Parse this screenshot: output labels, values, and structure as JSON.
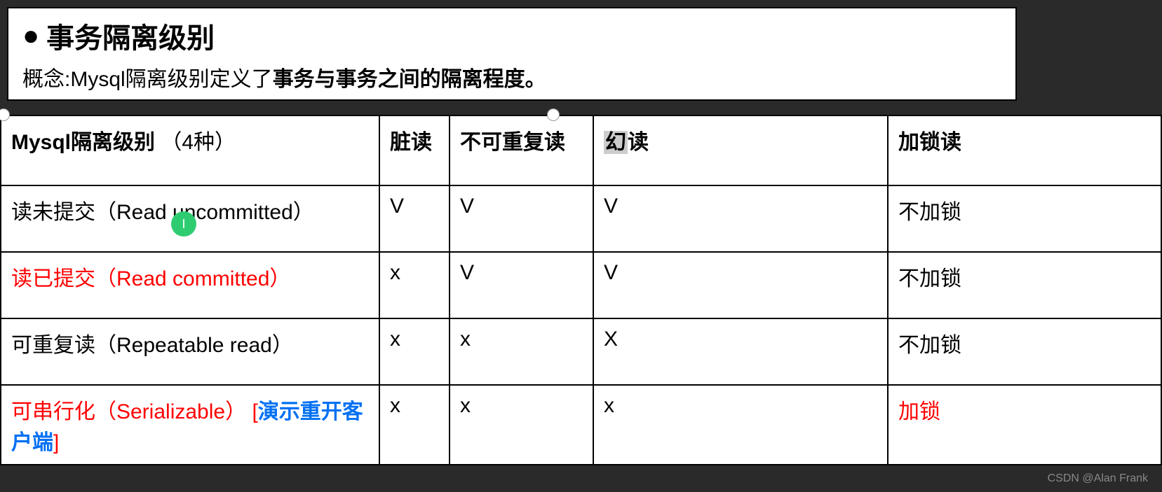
{
  "header": {
    "bullet": "●",
    "title": "事务隔离级别",
    "concept_prefix": "概念:Mysql隔离级别定义了",
    "concept_bold": "事务与事务之间的隔离程度。"
  },
  "table": {
    "headers": {
      "col1_main": "Mysql隔离级别",
      "col1_sub": "（4种）",
      "col2": "脏读",
      "col3": "不可重复读",
      "col4_prefix": "幻",
      "col4_suffix": "读",
      "col5": "加锁读"
    },
    "rows": [
      {
        "level": "读未提交（Read uncommitted）",
        "dirty": "V",
        "nonrepeat": "V",
        "phantom": "V",
        "lock": "不加锁",
        "style": "plain"
      },
      {
        "level": "读已提交（Read committed）",
        "dirty": "x",
        "nonrepeat": "V",
        "phantom": "V",
        "lock": "不加锁",
        "style": "red"
      },
      {
        "level": "可重复读（Repeatable read）",
        "dirty": "x",
        "nonrepeat": "x",
        "phantom": "X",
        "lock": "不加锁",
        "style": "plain"
      },
      {
        "level_red": "可串行化（Serializable）",
        "level_bracket_open": "[",
        "level_blue": "演示重开客户端",
        "level_bracket_close": "]",
        "dirty": "x",
        "nonrepeat": "x",
        "phantom": "x",
        "lock": "加锁",
        "lock_style": "red",
        "style": "serializable"
      }
    ]
  },
  "watermark": "CSDN @Alan Frank",
  "cursor_char": "I"
}
